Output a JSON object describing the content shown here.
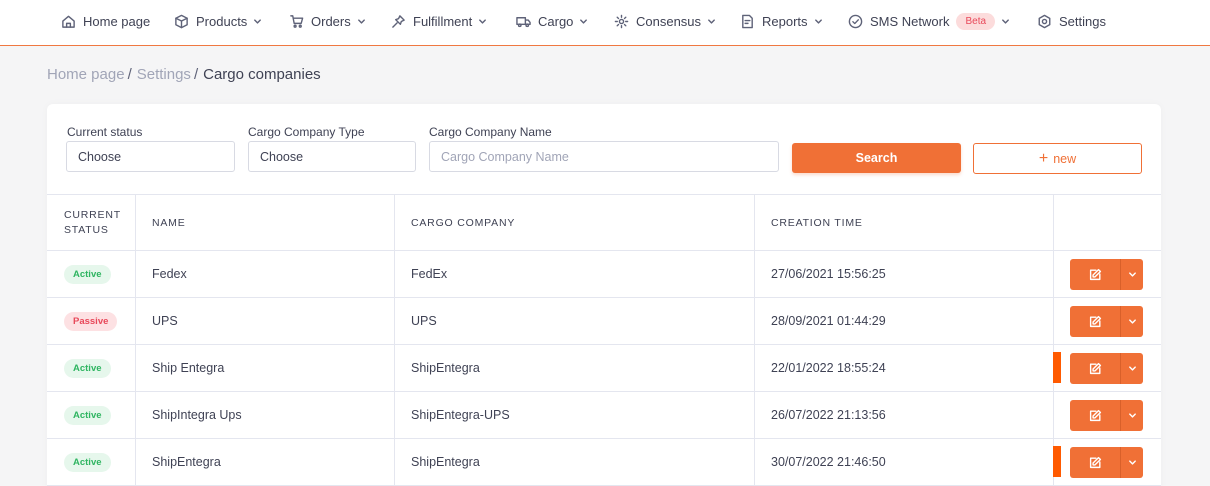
{
  "nav": [
    {
      "label": "Home page",
      "icon": "home-icon",
      "dropdown": false
    },
    {
      "label": "Products",
      "icon": "box-icon",
      "dropdown": true
    },
    {
      "label": "Orders",
      "icon": "cart-icon",
      "dropdown": true
    },
    {
      "label": "Fulfillment",
      "icon": "pin-icon",
      "dropdown": true
    },
    {
      "label": "Cargo",
      "icon": "truck-icon",
      "dropdown": true
    },
    {
      "label": "Consensus",
      "icon": "gear-circle-icon",
      "dropdown": true
    },
    {
      "label": "Reports",
      "icon": "report-icon",
      "dropdown": true
    },
    {
      "label": "SMS Network",
      "icon": "check-circle-icon",
      "dropdown": true,
      "badge": "Beta"
    },
    {
      "label": "Settings",
      "icon": "settings-icon",
      "dropdown": false
    }
  ],
  "breadcrumb": {
    "items": [
      "Home page",
      "Settings"
    ],
    "current": "Cargo companies"
  },
  "filters": {
    "status": {
      "label": "Current status",
      "value": "Choose"
    },
    "type": {
      "label": "Cargo Company Type",
      "value": "Choose"
    },
    "name": {
      "label": "Cargo Company Name",
      "placeholder": "Cargo Company Name"
    },
    "search_label": "Search",
    "new_label": "new"
  },
  "table": {
    "columns": [
      "CURRENT STATUS",
      "NAME",
      "CARGO COMPANY",
      "CREATION TIME"
    ],
    "rows": [
      {
        "status": "Active",
        "name": "Fedex",
        "company": "FedEx",
        "time": "27/06/2021 15:56:25"
      },
      {
        "status": "Passive",
        "name": "UPS",
        "company": "UPS",
        "time": "28/09/2021 01:44:29"
      },
      {
        "status": "Active",
        "name": "Ship Entegra",
        "company": "ShipEntegra",
        "time": "22/01/2022 18:55:24"
      },
      {
        "status": "Active",
        "name": "ShipIntegra Ups",
        "company": "ShipEntegra-UPS",
        "time": "26/07/2022 21:13:56"
      },
      {
        "status": "Active",
        "name": "ShipEntegra",
        "company": "ShipEntegra",
        "time": "30/07/2022 21:46:50"
      }
    ]
  },
  "colors": {
    "accent": "#f07036",
    "active_bg": "#e6f7ec",
    "active_fg": "#2fb561",
    "passive_bg": "#fde1e3",
    "passive_fg": "#e8495a",
    "marker": "#ff5a00"
  }
}
